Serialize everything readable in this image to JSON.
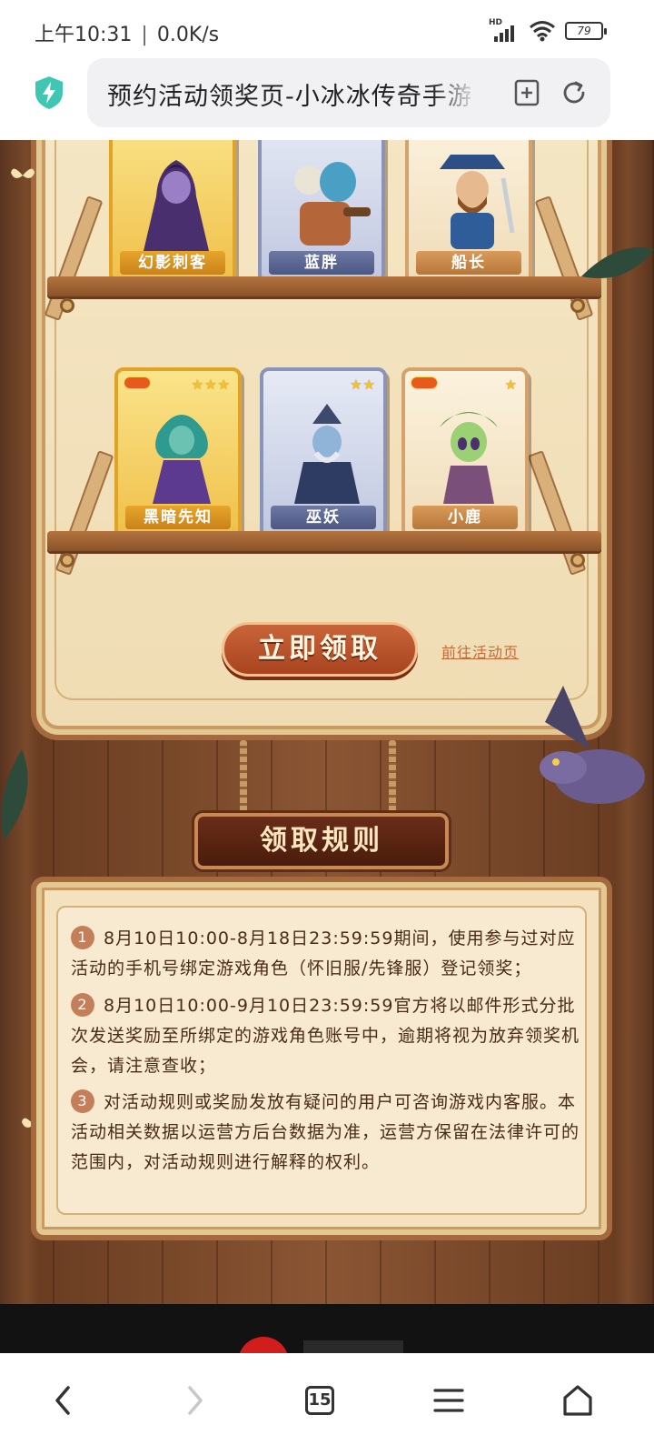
{
  "status_bar": {
    "time": "上午10:31",
    "speed": "0.0K/s",
    "battery": "79"
  },
  "address_bar": {
    "title": "预约活动领奖页-小冰冰传奇手游",
    "security_icon": "shield-lightning-icon"
  },
  "heroes": {
    "row1": [
      {
        "name": "幻影刺客",
        "rarity": "gold"
      },
      {
        "name": "蓝胖",
        "rarity": "silver"
      },
      {
        "name": "船长",
        "rarity": "bronze"
      }
    ],
    "row2": [
      {
        "name": "黑暗先知",
        "rarity": "gold",
        "stars": 3
      },
      {
        "name": "巫妖",
        "rarity": "silver",
        "stars": 2
      },
      {
        "name": "小鹿",
        "rarity": "bronze",
        "stars": 1
      }
    ]
  },
  "actions": {
    "claim_label": "立即领取",
    "activity_link": "前往活动页"
  },
  "rules": {
    "title": "领取规则",
    "items": [
      {
        "num": "1",
        "text": "8月10日10:00-8月18日23:59:59期间，使用参与过对应活动的手机号绑定游戏角色（怀旧服/先锋服）登记领奖；"
      },
      {
        "num": "2",
        "text": "8月10日10:00-9月10日23:59:59官方将以邮件形式分批次发送奖励至所绑定的游戏角色账号中，逾期将视为放弃领奖机会，请注意查收；"
      },
      {
        "num": "3",
        "text": "对活动规则或奖励发放有疑问的用户可咨询游戏内客服。本活动相关数据以运营方后台数据为准，运营方保留在法律许可的范围内，对活动规则进行解释的权利。"
      }
    ]
  },
  "nav": {
    "tab_count": "15"
  },
  "colors": {
    "accent": "#b24e27",
    "wood": "#7a4a2b",
    "parchment": "#f5e6c4"
  }
}
